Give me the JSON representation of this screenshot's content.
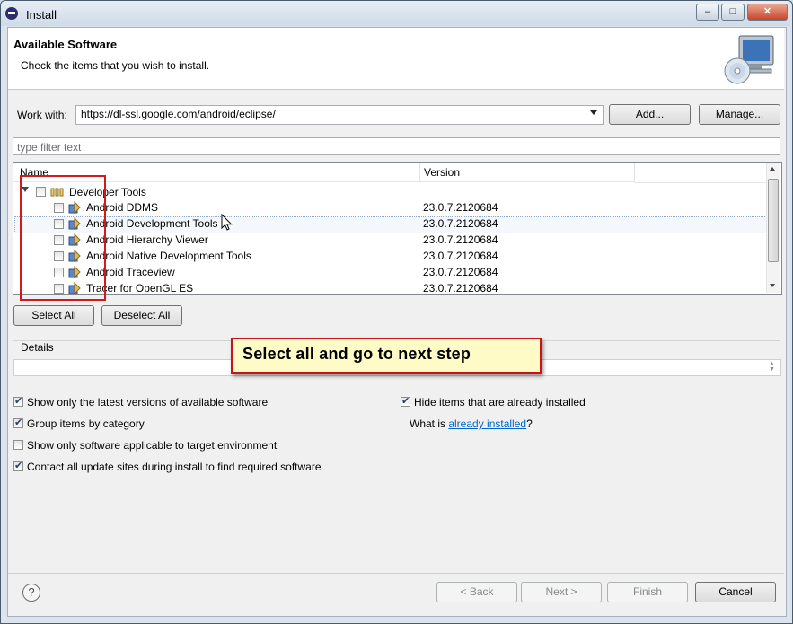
{
  "window": {
    "title": "Install",
    "minimize": "–",
    "maximize": "□",
    "close": "✕"
  },
  "header": {
    "title": "Available Software",
    "subtitle": "Check the items that you wish to install.",
    "art_icon": "cd-monitor-icon"
  },
  "work_with": {
    "label": "Work with:",
    "value": "https://dl-ssl.google.com/android/eclipse/",
    "add_label": "Add...",
    "manage_label": "Manage..."
  },
  "filter": {
    "placeholder": "type filter text"
  },
  "tree": {
    "columns": [
      "Name",
      "Version"
    ],
    "category": {
      "name": "Developer Tools",
      "checked": false,
      "expanded": true
    },
    "items": [
      {
        "name": "Android DDMS",
        "version": "23.0.7.2120684",
        "checked": false
      },
      {
        "name": "Android Development Tools",
        "version": "23.0.7.2120684",
        "checked": false
      },
      {
        "name": "Android Hierarchy Viewer",
        "version": "23.0.7.2120684",
        "checked": false
      },
      {
        "name": "Android Native Development Tools",
        "version": "23.0.7.2120684",
        "checked": false
      },
      {
        "name": "Android Traceview",
        "version": "23.0.7.2120684",
        "checked": false
      },
      {
        "name": "Tracer for OpenGL ES",
        "version": "23.0.7.2120684",
        "checked": false
      }
    ]
  },
  "buttons": {
    "select_all": "Select All",
    "deselect_all": "Deselect All"
  },
  "details": {
    "label": "Details"
  },
  "callout": {
    "text": "Select all and go to next step"
  },
  "options": {
    "show_latest": {
      "label": "Show only the latest versions of available software",
      "checked": true
    },
    "group_by_category": {
      "label": "Group items by category",
      "checked": true
    },
    "show_applicable": {
      "label": "Show only software applicable to target environment",
      "checked": false
    },
    "contact_sites": {
      "label": "Contact all update sites during install to find required software",
      "checked": true
    },
    "hide_installed": {
      "label": "Hide items that are already installed",
      "checked": true
    }
  },
  "installed_info": {
    "prefix": "What is ",
    "link": "already installed",
    "suffix": "?"
  },
  "footer": {
    "help": "?",
    "back": "< Back",
    "next": "Next >",
    "finish": "Finish",
    "cancel": "Cancel"
  }
}
